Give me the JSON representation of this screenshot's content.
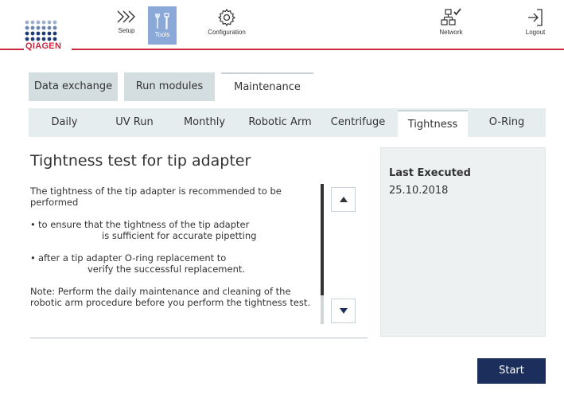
{
  "header": {
    "logo_text": "QIAGEN",
    "nav": {
      "setup": {
        "label": "Setup",
        "icon": "chevrons-right-icon"
      },
      "tools": {
        "label": "Tools",
        "icon": "tools-icon"
      },
      "configuration": {
        "label": "Configuration",
        "icon": "gear-icon"
      },
      "network": {
        "label": "Network",
        "icon": "network-icon"
      },
      "logout": {
        "label": "Logout",
        "icon": "logout-icon"
      }
    },
    "accent_color": "#c9283e"
  },
  "main_tabs": [
    {
      "label": "Data exchange",
      "active": false
    },
    {
      "label": "Run modules",
      "active": false
    },
    {
      "label": "Maintenance",
      "active": true
    }
  ],
  "sub_tabs": [
    {
      "label": "Daily",
      "active": false
    },
    {
      "label": "UV Run",
      "active": false
    },
    {
      "label": "Monthly",
      "active": false
    },
    {
      "label": "Robotic Arm",
      "active": false
    },
    {
      "label": "Centrifuge",
      "active": false
    },
    {
      "label": "Tightness",
      "active": true
    },
    {
      "label": "O-Ring",
      "active": false
    }
  ],
  "content": {
    "title": "Tightness test for tip adapter",
    "intro": "The tightness of the tip adapter is recommended to be performed",
    "bullet1_line1": "to ensure that the tightness of the tip adapter",
    "bullet1_line2": "is sufficient for accurate pipetting",
    "bullet2_line1": "after a tip adapter O-ring replacement to",
    "bullet2_line2": "verify the successful replacement.",
    "note": "Note: Perform the daily maintenance and cleaning of the robotic arm procedure before you perform the tightness test."
  },
  "side_panel": {
    "label": "Last Executed",
    "value": "25.10.2018"
  },
  "actions": {
    "start_label": "Start"
  },
  "colors": {
    "primary_button": "#1c2f5c",
    "tab_inactive": "#d4dee1",
    "tools_highlight": "#8aa8d8"
  }
}
